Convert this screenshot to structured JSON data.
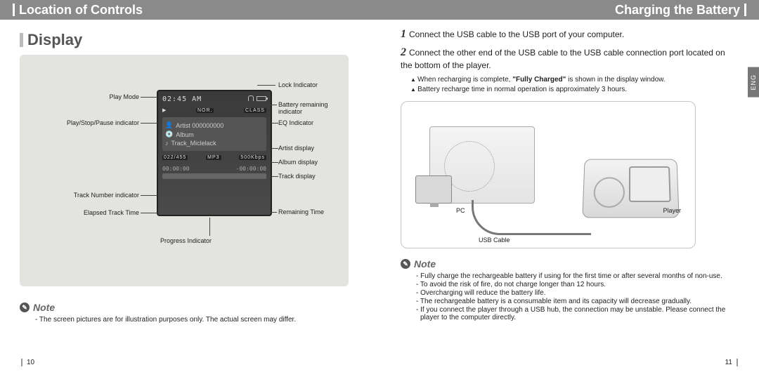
{
  "topbar": {
    "left_title": "Location of Controls",
    "right_title": "Charging the Battery"
  },
  "lang_tab": "ENG",
  "page_left": "10",
  "page_right": "11",
  "display": {
    "heading": "Display",
    "screen": {
      "time": "02:45 AM",
      "play_icon": "▶",
      "nor_tag": "NOR.",
      "eq_tag": "CLASS",
      "artist_line": "Artist 000000000",
      "album_line": "Album",
      "track_line": "Track_Miclelack",
      "track_num": "022/455",
      "mp3": "MP3",
      "bitrate": "500Kbps",
      "elapsed": "00:00:00",
      "remaining": "-00:00:00"
    },
    "callouts_left": {
      "play_mode": "Play Mode",
      "play_stop_pause": "Play/Stop/Pause indicator",
      "track_number": "Track Number indicator",
      "elapsed": "Elapsed Track Time",
      "progress": "Progress Indicator"
    },
    "callouts_right": {
      "lock": "Lock Indicator",
      "battery": "Battery remaining indicator",
      "eq": "EQ Indicator",
      "artist": "Artist display",
      "album": "Album display",
      "track": "Track display",
      "remaining": "Remaining Time"
    },
    "note_label": "Note",
    "note_line": "- The screen pictures are for illustration purposes only. The actual screen may differ."
  },
  "charging": {
    "step1_num": "1",
    "step1_text": "Connect the USB cable to the USB port of your computer.",
    "step2_num": "2",
    "step2_text": "Connect the other end of the USB cable to the USB cable connection port located on the bottom of the player.",
    "sub1": "When recharging is complete, \"Fully Charged\" is shown in the display window.",
    "sub1_bold": "Fully Charged",
    "sub2": "Battery recharge time in normal operation is approximately 3 hours.",
    "labels": {
      "pc": "PC",
      "usb": "USB Cable",
      "player": "Player"
    },
    "note_label": "Note",
    "notes": [
      "- Fully charge the rechargeable battery if using for the first time or after several months of non-use.",
      "- To avoid the risk of fire, do not charge longer than 12 hours.",
      "- Overcharging will reduce the battery life.",
      "- The rechargeable battery is a consumable item and its capacity will decrease gradually.",
      "- If you connect the player through a USB hub, the connection may be unstable. Please connect the player to the computer directly."
    ]
  }
}
